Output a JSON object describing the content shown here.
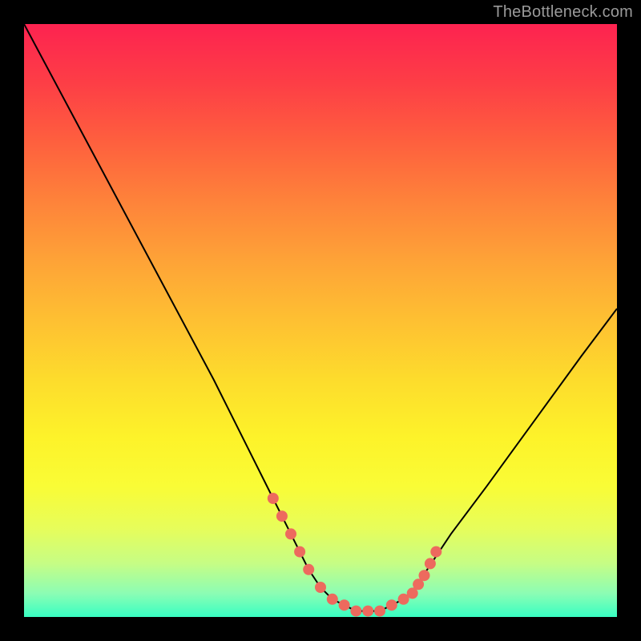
{
  "watermark": "TheBottleneck.com",
  "chart_data": {
    "type": "line",
    "title": "",
    "xlabel": "",
    "ylabel": "",
    "xlim": [
      0,
      100
    ],
    "ylim": [
      0,
      100
    ],
    "grid": false,
    "series": [
      {
        "name": "curve",
        "color": "#000000",
        "x": [
          0,
          8,
          16,
          24,
          32,
          38,
          42,
          46,
          48,
          50,
          52,
          54,
          56,
          58,
          60,
          62,
          64,
          66,
          68,
          72,
          78,
          86,
          94,
          100
        ],
        "y": [
          100,
          85,
          70,
          55,
          40,
          28,
          20,
          12,
          8,
          5,
          3,
          2,
          1,
          1,
          1,
          2,
          3,
          5,
          8,
          14,
          22,
          33,
          44,
          52
        ]
      }
    ],
    "markers": {
      "name": "highlight-dots",
      "color": "#ed6a5e",
      "x": [
        42,
        43.5,
        45,
        46.5,
        48,
        50,
        52,
        54,
        56,
        58,
        60,
        62,
        64,
        65.5,
        66.5,
        67.5,
        68.5,
        69.5
      ],
      "y": [
        20,
        17,
        14,
        11,
        8,
        5,
        3,
        2,
        1,
        1,
        1,
        2,
        3,
        4,
        5.5,
        7,
        9,
        11
      ]
    },
    "background_gradient": {
      "top": "#fd2350",
      "bottom": "#38ffc2"
    }
  }
}
